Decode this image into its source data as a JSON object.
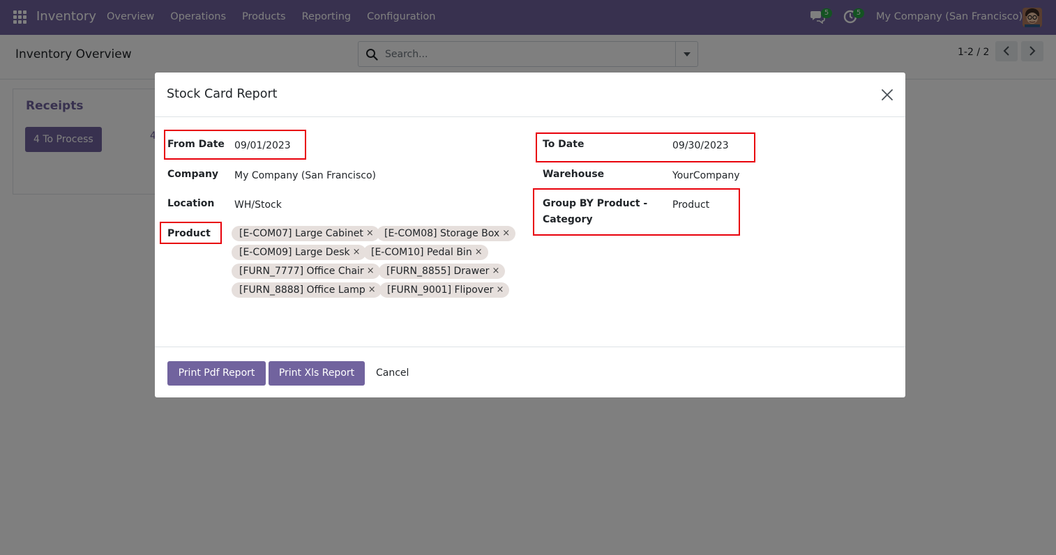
{
  "navbar": {
    "brand": "Inventory",
    "menu": [
      "Overview",
      "Operations",
      "Products",
      "Reporting",
      "Configuration"
    ],
    "messages_count": "5",
    "activities_count": "5",
    "company": "My Company (San Francisco)"
  },
  "control_panel": {
    "title": "Inventory Overview",
    "search_placeholder": "Search...",
    "pager": "1-2 / 2"
  },
  "dashboard": {
    "card_title": "Receipts",
    "process_label": "4 To Process",
    "stat": "4"
  },
  "modal": {
    "title": "Stock Card Report",
    "left_fields": {
      "from_date_label": "From Date",
      "from_date_value": "09/01/2023",
      "company_label": "Company",
      "company_value": "My Company (San Francisco)",
      "location_label": "Location",
      "location_value": "WH/Stock",
      "product_label": "Product"
    },
    "right_fields": {
      "to_date_label": "To Date",
      "to_date_value": "09/30/2023",
      "warehouse_label": "Warehouse",
      "warehouse_value": "YourCompany",
      "group_by_label_line1": "Group BY Product -",
      "group_by_label_line2": "Category",
      "group_by_value": "Product"
    },
    "products": [
      "[E-COM07] Large Cabinet",
      "[E-COM08] Storage Box",
      "[E-COM09] Large Desk",
      "[E-COM10] Pedal Bin",
      "[FURN_7777] Office Chair",
      "[FURN_8855] Drawer",
      "[FURN_8888] Office Lamp",
      "[FURN_9001] Flipover"
    ],
    "tag_remove": "×",
    "buttons": {
      "pdf": "Print Pdf Report",
      "xls": "Print Xls Report",
      "cancel": "Cancel"
    }
  },
  "colors": {
    "brand": "#71639e",
    "highlight": "#e8000b",
    "tag_bg": "#e6dfdc",
    "badge": "#28a745"
  }
}
